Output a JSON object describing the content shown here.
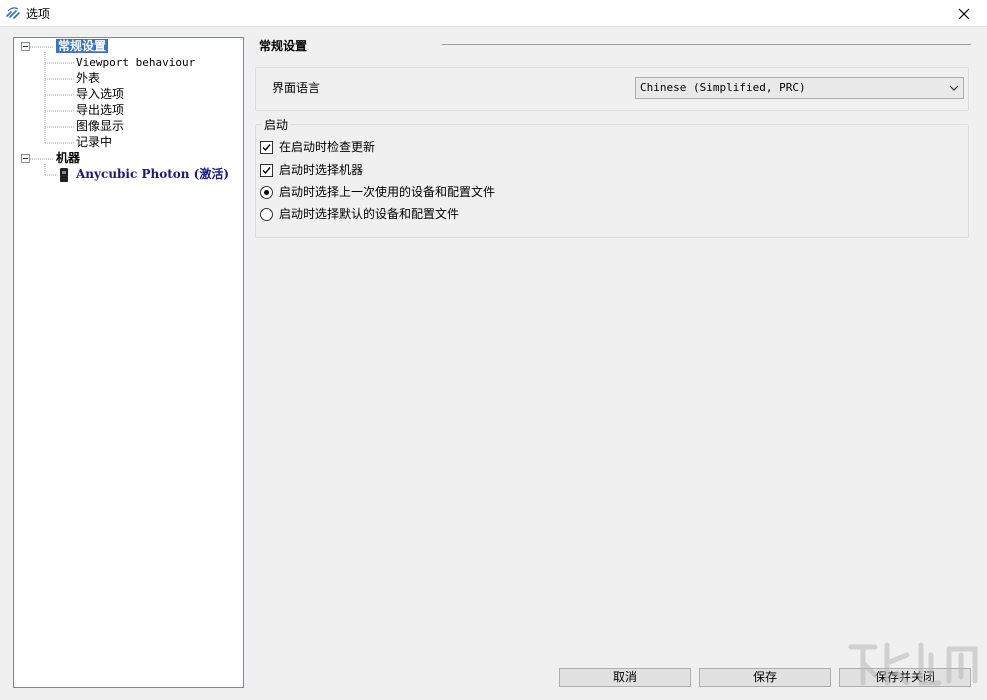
{
  "window": {
    "title": "选项"
  },
  "tree": {
    "general": "常规设置",
    "children": [
      "Viewport behaviour",
      "外表",
      "导入选项",
      "导出选项",
      "图像显示",
      "记录中"
    ],
    "machines": "机器",
    "machine_item": "Anycubic Photon (激活)"
  },
  "main": {
    "section_title": "常规设置",
    "language": {
      "label": "界面语言",
      "selected": "Chinese (Simplified, PRC)"
    },
    "startup": {
      "legend": "启动",
      "options": [
        "在启动时检查更新",
        "启动时选择机器",
        "启动时选择上一次使用的设备和配置文件",
        "启动时选择默认的设备和配置文件"
      ]
    }
  },
  "buttons": {
    "cancel": "取消",
    "save": "保存",
    "save_close": "保存并关闭"
  }
}
